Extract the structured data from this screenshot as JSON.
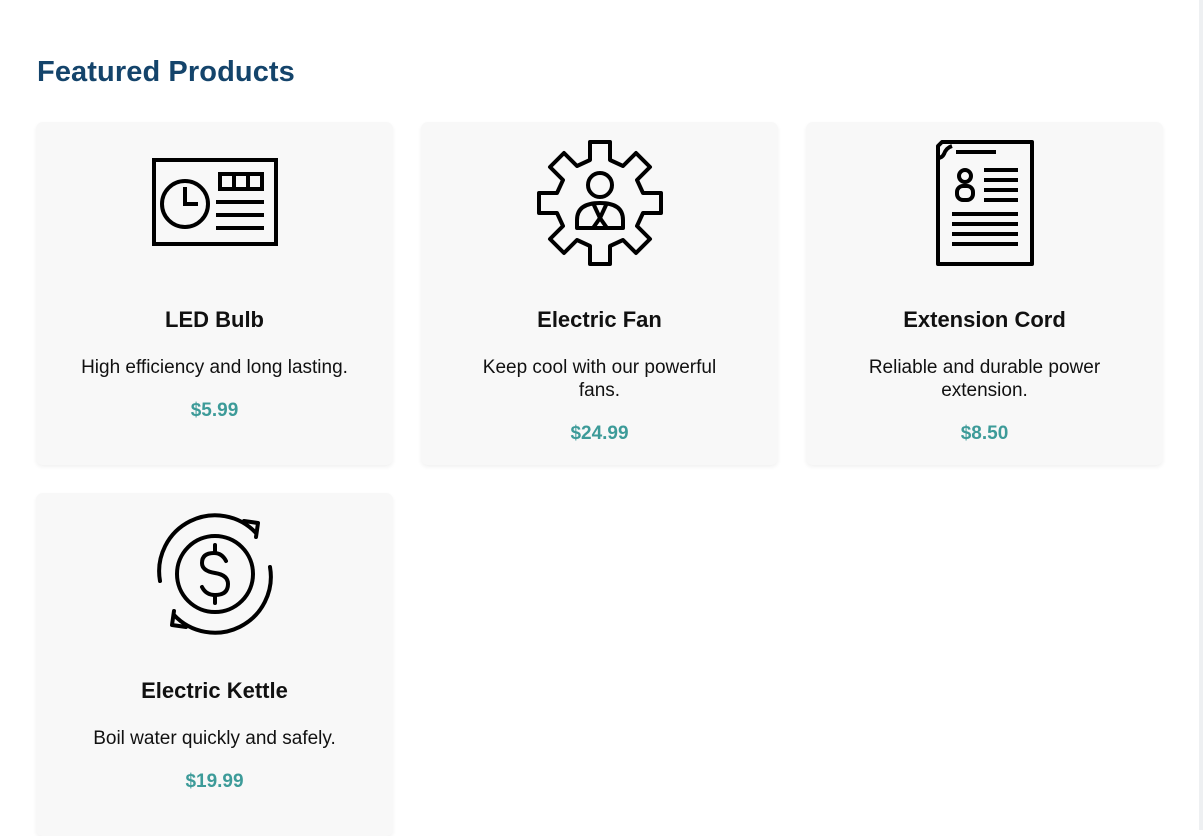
{
  "section": {
    "title": "Featured Products"
  },
  "products": [
    {
      "name": "LED Bulb",
      "description": "High efficiency and long lasting.",
      "price": "$5.99",
      "icon": "clock-panel-icon"
    },
    {
      "name": "Electric Fan",
      "description": "Keep cool with our powerful fans.",
      "price": "$24.99",
      "icon": "gear-person-icon"
    },
    {
      "name": "Extension Cord",
      "description": "Reliable and durable power extension.",
      "price": "$8.50",
      "icon": "document-icon"
    },
    {
      "name": "Electric Kettle",
      "description": "Boil water quickly and safely.",
      "price": "$19.99",
      "icon": "dollar-cycle-icon"
    }
  ],
  "colors": {
    "title": "#14446b",
    "price": "#3d9b99",
    "card_bg": "#f8f8f8"
  }
}
